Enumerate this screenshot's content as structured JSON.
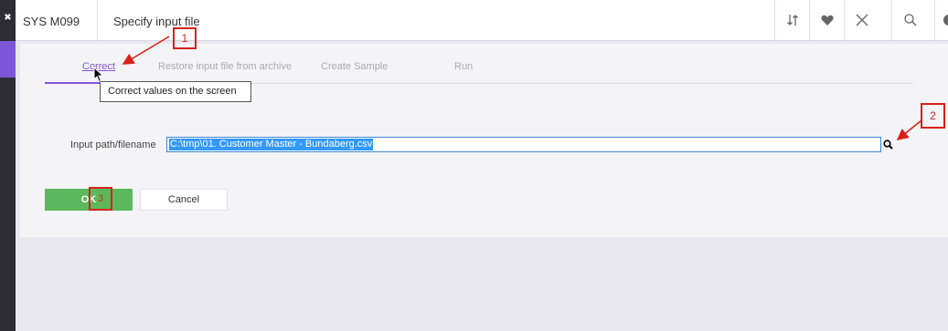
{
  "app": {
    "program": "SYS M099",
    "title": "Specify input file"
  },
  "toolbar": {
    "icons": [
      "sort-icon",
      "heart-icon",
      "close-icon",
      "search-icon",
      "info-icon"
    ]
  },
  "tabs": [
    {
      "label": "Correct",
      "active": true
    },
    {
      "label": "Restore input file from archive",
      "active": false
    },
    {
      "label": "Create Sample",
      "active": false
    },
    {
      "label": "Run",
      "active": false
    }
  ],
  "tooltip": "Correct values on the screen",
  "form": {
    "input_label": "Input path/filename",
    "input_value": "C:\\tmp\\01. Customer Master - Bundaberg.csv"
  },
  "buttons": {
    "ok": "OK",
    "cancel": "Cancel"
  },
  "callouts": [
    "1",
    "2",
    "3"
  ],
  "colors": {
    "accent": "#7f56d9",
    "ok_green": "#5cb85c",
    "callout_red": "#d9211b",
    "selection_blue": "#3399ff"
  }
}
